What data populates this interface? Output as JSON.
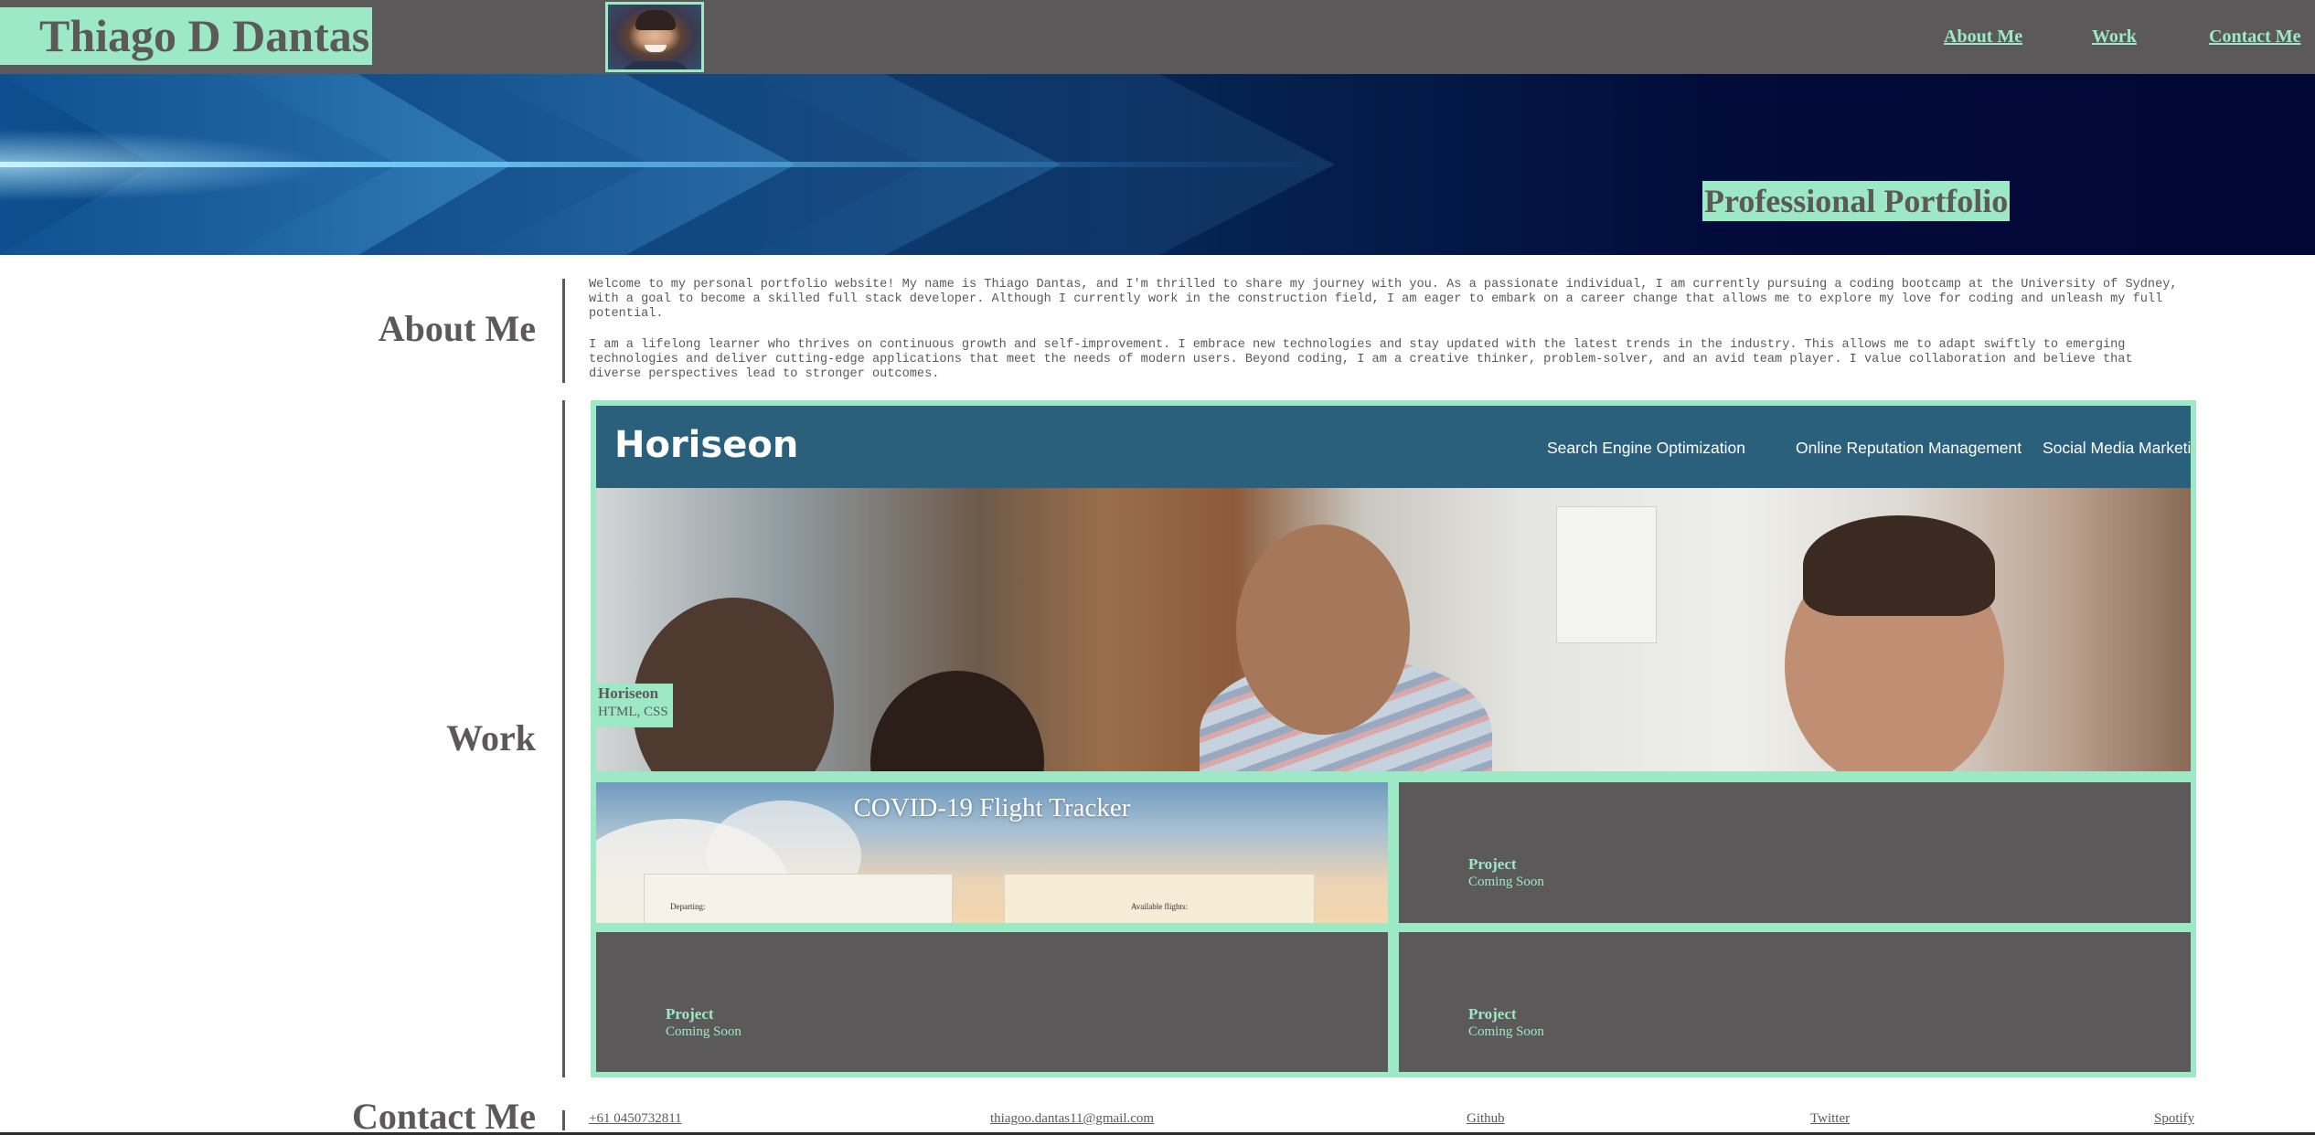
{
  "header": {
    "name": "Thiago D Dantas",
    "nav": [
      {
        "label": "About Me"
      },
      {
        "label": "Work"
      },
      {
        "label": "Contact Me"
      }
    ]
  },
  "hero": {
    "title": "Professional Portfolio"
  },
  "about": {
    "heading": "About Me",
    "paragraphs": [
      "Welcome to my personal portfolio website! My name is Thiago Dantas, and I'm thrilled to share my journey with you. As a passionate individual, I am currently pursuing a coding bootcamp at the University of Sydney, with a goal to become a skilled full stack developer. Although I currently work in the construction field, I am eager to embark on a career change that allows me to explore my love for coding and unleash my full potential.",
      "I am a lifelong learner who thrives on continuous growth and self-improvement. I embrace new technologies and stay updated with the latest trends in the industry. This allows me to adapt swiftly to emerging technologies and deliver cutting-edge applications that meet the needs of modern users. Beyond coding, I am a creative thinker, problem-solver, and an avid team player. I value collaboration and believe that diverse perspectives lead to stronger outcomes."
    ]
  },
  "work": {
    "heading": "Work",
    "featured": {
      "title": "Horiseon",
      "tech": "HTML, CSS",
      "screenshot": {
        "logo": "Horiseon",
        "nav": [
          "Search Engine Optimization",
          "Online Reputation Management",
          "Social Media Marketing"
        ]
      }
    },
    "covid": {
      "title": "COVID-19 Flight Tracker",
      "left_panel": "Departing:",
      "right_panel": "Available flights:"
    },
    "placeholders": [
      {
        "title": "Project",
        "subtitle": "Coming Soon"
      },
      {
        "title": "Project",
        "subtitle": "Coming Soon"
      },
      {
        "title": "Project",
        "subtitle": "Coming Soon"
      }
    ]
  },
  "contact": {
    "heading": "Contact Me",
    "links": [
      {
        "label": "+61 0450732811"
      },
      {
        "label": "thiagoo.dantas11@gmail.com"
      },
      {
        "label": "Github"
      },
      {
        "label": "Twitter"
      },
      {
        "label": "Spotify"
      }
    ]
  },
  "colors": {
    "accent": "#9ee9c5",
    "dark": "#5b5959",
    "horiseon_bar": "#2a607c"
  }
}
